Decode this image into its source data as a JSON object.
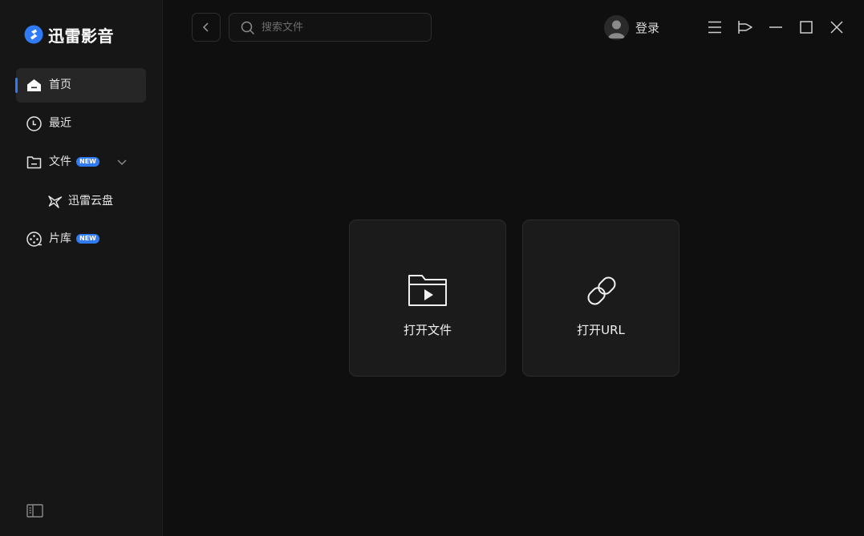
{
  "app": {
    "title": "迅雷影音",
    "brand_color": "#2f7bf5"
  },
  "sidebar": {
    "items": [
      {
        "label": "首页",
        "icon": "home-icon"
      },
      {
        "label": "最近",
        "icon": "clock-icon"
      },
      {
        "label": "文件",
        "icon": "folder-icon",
        "badge": "NEW"
      },
      {
        "label": "迅雷云盘",
        "icon": "cloud-drive-icon"
      },
      {
        "label": "片库",
        "icon": "film-reel-icon",
        "badge": "NEW"
      }
    ],
    "collapse_icon": "sidebar-toggle-icon"
  },
  "header": {
    "search_placeholder": "搜索文件",
    "login_label": "登录"
  },
  "main": {
    "open_file_label": "打开文件",
    "open_url_label": "打开URL"
  }
}
